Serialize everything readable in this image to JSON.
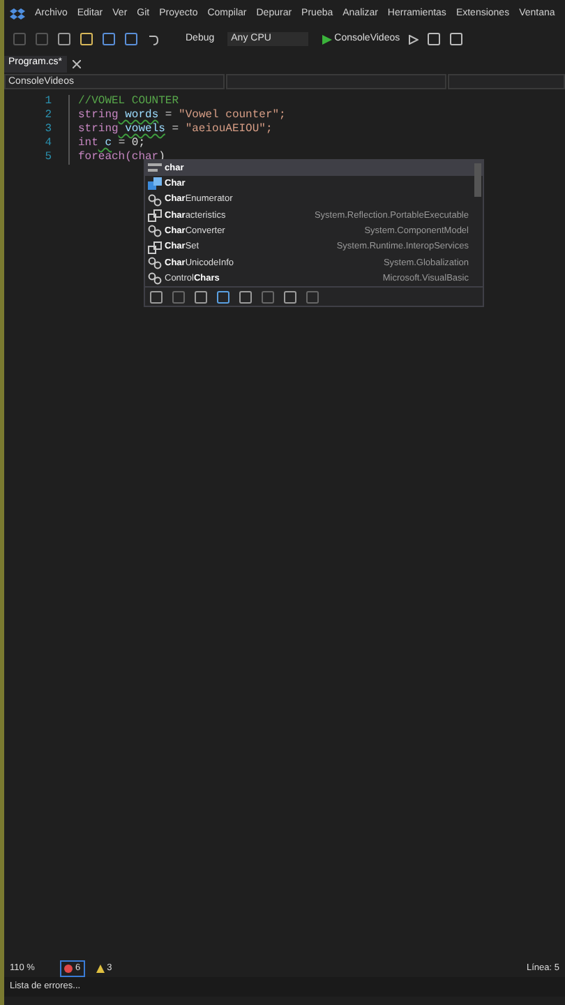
{
  "menu": [
    "Archivo",
    "Editar",
    "Ver",
    "Git",
    "Proyecto",
    "Compilar",
    "Depurar",
    "Prueba",
    "Analizar",
    "Herramientas",
    "Extensiones",
    "Ventana"
  ],
  "toolbar": {
    "configuration": "Debug",
    "platform": "Any CPU",
    "start": "ConsoleVideos"
  },
  "tabs": [
    {
      "label": "Program.cs*",
      "selected": true
    }
  ],
  "nav_bar": {
    "project": "ConsoleVideos"
  },
  "code": [
    {
      "number": "1",
      "tokens": [
        {
          "kind": "comment",
          "text": "//VOWEL COUNTER"
        }
      ]
    },
    {
      "number": "2",
      "tokens": [
        {
          "kind": "keyword",
          "text": "string"
        },
        {
          "kind": "warn",
          "text": "words"
        },
        {
          "kind": "plain",
          "text": "="
        },
        {
          "kind": "string",
          "text": "\"Vowel counter\";"
        }
      ]
    },
    {
      "number": "3",
      "tokens": [
        {
          "kind": "keyword",
          "text": "string"
        },
        {
          "kind": "warn",
          "text": "vowels"
        },
        {
          "kind": "plain",
          "text": "="
        },
        {
          "kind": "string",
          "text": "\"aeiouAEIOU\";"
        }
      ]
    },
    {
      "number": "4",
      "tokens": [
        {
          "kind": "keyword",
          "text": "int"
        },
        {
          "kind": "warn",
          "text": "c"
        },
        {
          "kind": "plain",
          "text": "= 0;"
        }
      ]
    },
    {
      "number": "5",
      "tokens": [
        {
          "kind": "keyword",
          "text": "foreach(char"
        },
        {
          "kind": "plain",
          "text": ")"
        }
      ]
    }
  ],
  "completion": {
    "items": [
      {
        "kind": "keyword",
        "match": "char",
        "selected": true
      },
      {
        "kind": "struct",
        "match": "Char",
        "selected": false
      },
      {
        "kind": "struct-alt",
        "match": "Char",
        "after": "Enumerator",
        "selected": false
      },
      {
        "kind": "enum",
        "match": "Char",
        "after": "acteristics",
        "namespace": "System.Reflection.PortableExecutable",
        "selected": false
      },
      {
        "kind": "struct-alt",
        "match": "Char",
        "after": "Converter",
        "namespace": "System.ComponentModel",
        "selected": false
      },
      {
        "kind": "enum",
        "match": "Char",
        "after": "Set",
        "namespace": "System.Runtime.InteropServices",
        "selected": false
      },
      {
        "kind": "struct-alt",
        "match": "Char",
        "after": "UnicodeInfo",
        "namespace": "System.Globalization",
        "selected": false
      },
      {
        "kind": "struct-alt",
        "before": "Control",
        "match": "Chars",
        "namespace": "Microsoft.VisualBasic",
        "selected": false
      }
    ]
  },
  "status_bar": {
    "zoom": "110 %",
    "errors": "6",
    "warnings": "3",
    "line": "Línea: 5"
  },
  "bottom_tab": "Lista de errores..."
}
